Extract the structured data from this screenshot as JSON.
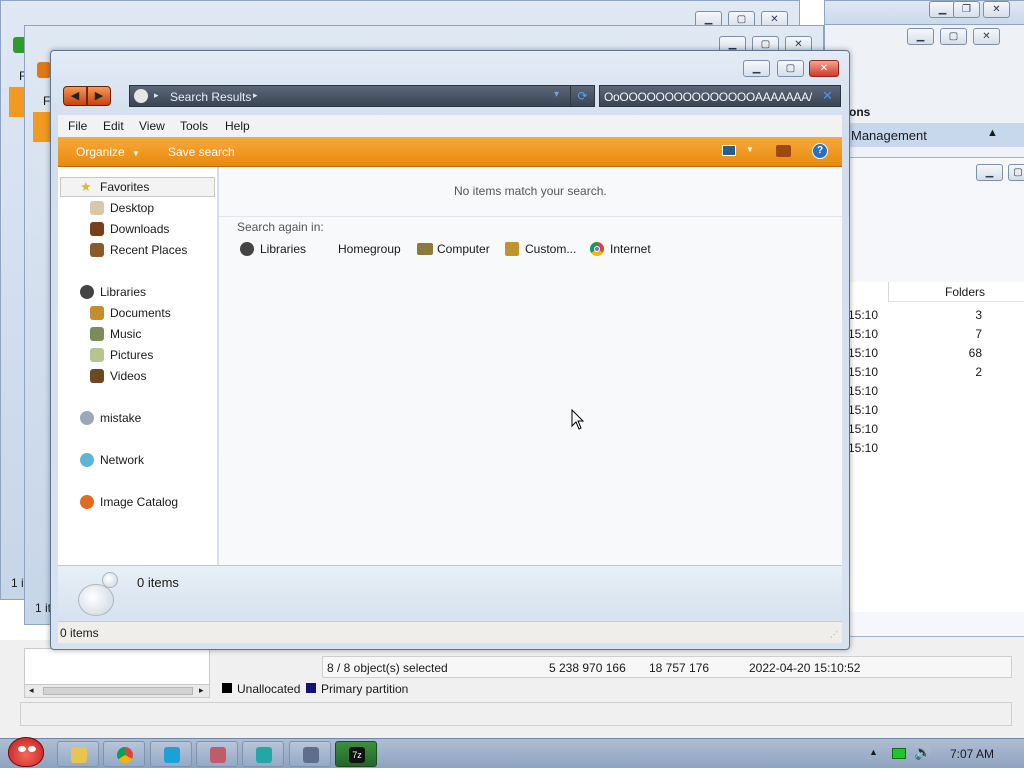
{
  "window": {
    "address_label": "Search Results",
    "search_query": "OoOOOOOOOOOOOOOOOAAAAAAA/",
    "menu": [
      "File",
      "Edit",
      "View",
      "Tools",
      "Help"
    ],
    "toolbar": {
      "organize": "Organize",
      "save_search": "Save search"
    },
    "nav": {
      "favorites": "Favorites",
      "desktop": "Desktop",
      "downloads": "Downloads",
      "recent": "Recent Places",
      "libraries": "Libraries",
      "documents": "Documents",
      "music": "Music",
      "pictures": "Pictures",
      "videos": "Videos",
      "mistake": "mistake",
      "network": "Network",
      "image_catalog": "Image Catalog"
    },
    "content": {
      "empty_message": "No items match your search.",
      "search_again": "Search again in:",
      "targets": [
        "Libraries",
        "Homegroup",
        "Computer",
        "Custom...",
        "Internet"
      ]
    },
    "details_count": "0 items",
    "status_count": "0 items"
  },
  "bg_left": {
    "menu_f": "F",
    "status_1": "1 it",
    "status_2": "1 it"
  },
  "bg_right": {
    "section_header": "ons",
    "management": "Management",
    "col_folders": "Folders",
    "rows": [
      {
        "time": "15:10",
        "folders": "3"
      },
      {
        "time": "15:10",
        "folders": "7"
      },
      {
        "time": "15:10",
        "folders": "68"
      },
      {
        "time": "15:10",
        "folders": "2"
      },
      {
        "time": "15:10",
        "folders": ""
      },
      {
        "time": "15:10",
        "folders": ""
      },
      {
        "time": "15:10",
        "folders": ""
      },
      {
        "time": "15:10",
        "folders": ""
      }
    ]
  },
  "partition": {
    "selected": "8 / 8 object(s) selected",
    "size": "5 238 970 166",
    "count": "18 757 176",
    "date": "2022-04-20 15:10:52",
    "legend_unallocated": "Unallocated",
    "legend_primary": "Primary partition"
  },
  "taskbar": {
    "clock": "7:07 AM"
  },
  "colors": {
    "accent_orange": "#f29a1f",
    "close_red": "#d0392c"
  }
}
